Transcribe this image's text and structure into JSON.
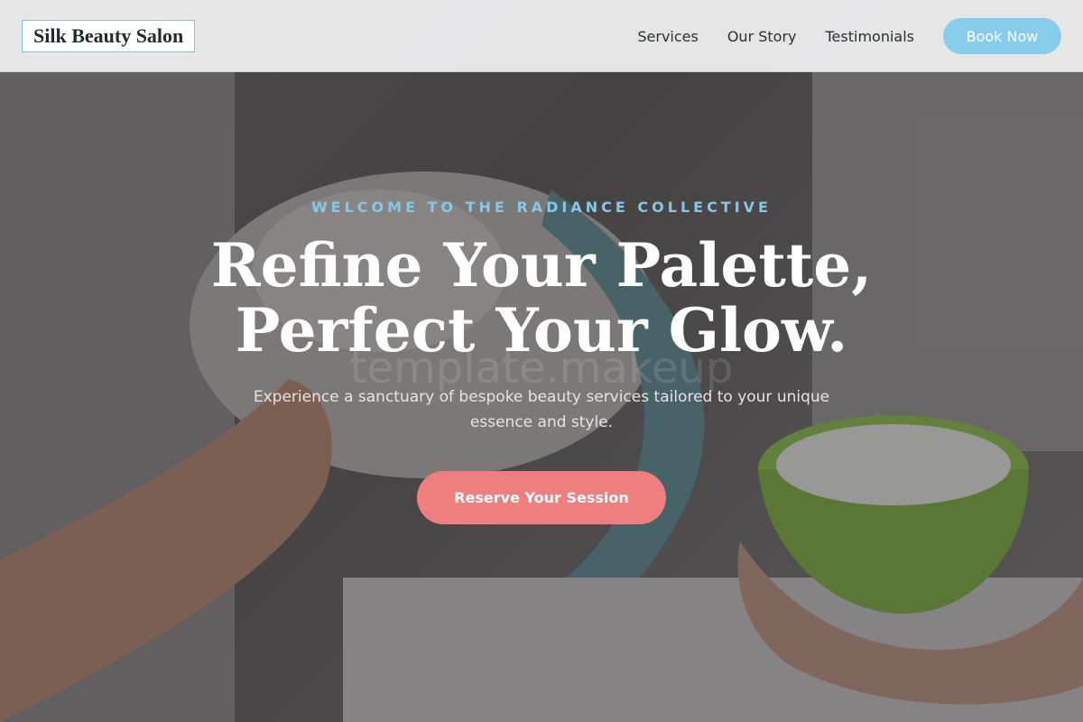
{
  "brand": {
    "name": "Silk Beauty Salon"
  },
  "nav": {
    "links": [
      {
        "label": "Services"
      },
      {
        "label": "Our Story"
      },
      {
        "label": "Testimonials"
      }
    ],
    "cta_label": "Book Now"
  },
  "hero": {
    "eyebrow": "WELCOME TO THE RADIANCE COLLECTIVE",
    "headline_line1": "Refine Your Palette,",
    "headline_line2": "Perfect Your Glow.",
    "subtext": "Experience a sanctuary of bespoke beauty services tailored to your unique essence and style.",
    "cta_label": "Reserve Your Session",
    "watermark": "template.makeup"
  },
  "colors": {
    "accent_blue": "#87cceb",
    "accent_coral": "#ef7f7f",
    "logo_border": "#7fc6e0"
  }
}
